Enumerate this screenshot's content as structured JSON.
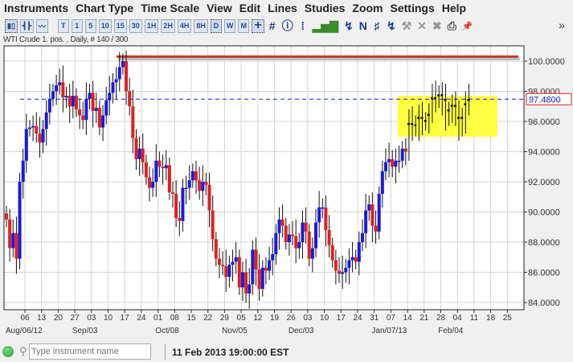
{
  "menu": [
    "Instruments",
    "Chart Type",
    "Time Scale",
    "View",
    "Edit",
    "Lines",
    "Studies",
    "Zoom",
    "Settings",
    "Help"
  ],
  "toolbar": {
    "timeframes": [
      "T",
      "1",
      "5",
      "10",
      "15",
      "30",
      "1H",
      "2H",
      "4H",
      "8H",
      "D",
      "W",
      "M"
    ],
    "selected": "D",
    "more": "»"
  },
  "chart_title": "WTI Crude 1. pos. , Daily, # 140 / 300",
  "status": {
    "search_placeholder": "Type instrument name",
    "datetime": "11 Feb 2013 19:00:00 EST",
    "connection_color": "#2e9a4a"
  },
  "chart_data": {
    "type": "candlestick",
    "instrument": "WTI Crude 1. pos.",
    "ylim": [
      83.5,
      101.5
    ],
    "yticks": [
      "100.0000",
      "98.0000",
      "96.0000",
      "94.0000",
      "92.0000",
      "90.0000",
      "88.0000",
      "86.0000",
      "84.0000"
    ],
    "ytick_values": [
      100,
      98,
      96,
      94,
      92,
      90,
      88,
      86,
      84
    ],
    "last_price": 97.48,
    "last_price_label": "97.4800",
    "xticks": [
      "06",
      "13",
      "20",
      "27",
      "03",
      "10",
      "17",
      "24",
      "01",
      "08",
      "15",
      "22",
      "29",
      "05",
      "12",
      "19",
      "26",
      "03",
      "10",
      "17",
      "24",
      "31",
      "07",
      "14",
      "21",
      "28",
      "04",
      "11",
      "18",
      "25"
    ],
    "month_labels": [
      "Aug/06/12",
      "Sep/03",
      "Oct/08",
      "Nov/05",
      "Dec/03",
      "Jan/07/13",
      "Feb/04"
    ],
    "month_label_week_index": [
      0,
      4,
      9,
      13,
      17,
      22,
      26
    ],
    "resistance_line": 100.3,
    "range_box": {
      "from_bar": 120,
      "to_bar": 150,
      "low": 95.0,
      "high": 97.7
    },
    "colors": {
      "up": "#1a1adf",
      "down": "#e02020",
      "neutral": "#111111",
      "resistance": "#c0392b",
      "box": "#ffff44",
      "last": "#1a1adf"
    },
    "closes": [
      89.5,
      87.6,
      88.6,
      86.9,
      92.0,
      93.4,
      95.5,
      95.6,
      95.7,
      95.2,
      94.6,
      95.5,
      96.6,
      97.5,
      98.0,
      98.4,
      98.6,
      97.6,
      97.7,
      97.0,
      97.7,
      96.8,
      96.4,
      96.1,
      97.5,
      97.9,
      96.7,
      96.9,
      95.6,
      96.4,
      97.4,
      97.9,
      98.6,
      98.8,
      99.6,
      100.0,
      98.0,
      97.0,
      94.9,
      93.5,
      94.2,
      93.3,
      92.3,
      91.6,
      92.0,
      93.4,
      93.0,
      92.9,
      93.1,
      91.3,
      91.2,
      89.6,
      89.4,
      91.6,
      91.6,
      92.1,
      92.7,
      92.1,
      91.4,
      92.0,
      91.8,
      90.1,
      88.2,
      86.9,
      86.5,
      86.4,
      85.7,
      86.5,
      86.7,
      87.0,
      85.0,
      86.0,
      84.6,
      85.2,
      87.5,
      86.2,
      84.9,
      86.3,
      86.1,
      86.8,
      87.2,
      88.6,
      89.5,
      89.1,
      88.0,
      88.5,
      88.4,
      87.6,
      88.0,
      89.3,
      88.7,
      86.9,
      87.6,
      89.3,
      90.3,
      90.3,
      88.8,
      87.8,
      86.8,
      86.1,
      85.9,
      86.0,
      86.3,
      86.8,
      87.0,
      86.7,
      88.0,
      88.6,
      90.1,
      90.5,
      89.1,
      88.7,
      91.2,
      92.7,
      93.3,
      93.5,
      93.0,
      93.4,
      93.4,
      94.2,
      94.0,
      95.9,
      95.7,
      95.8,
      96.3,
      95.9,
      96.1,
      96.5,
      97.6,
      97.6,
      97.8,
      97.5,
      96.2,
      96.8,
      97.1,
      96.3,
      95.7,
      96.3,
      97.2,
      97.5
    ]
  }
}
